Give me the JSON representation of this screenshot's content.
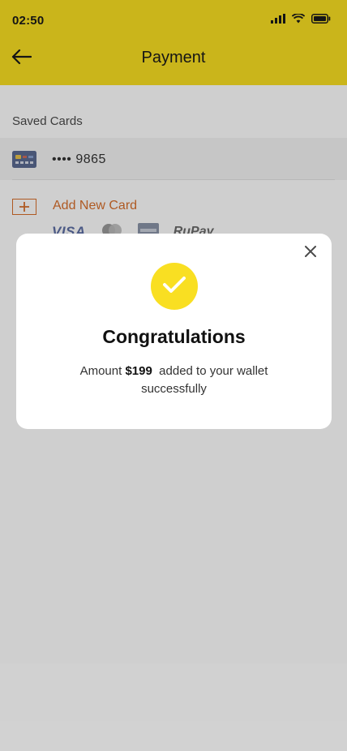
{
  "status_bar": {
    "time": "02:50",
    "signal_icon": "cellular-signal-icon",
    "wifi_icon": "wifi-icon",
    "battery_icon": "battery-icon"
  },
  "header": {
    "title": "Payment",
    "back_icon": "arrow-left-icon",
    "color": "#f9df22"
  },
  "saved_cards": {
    "section_title": "Saved Cards",
    "cards": [
      {
        "masked_number": "•••• 9865",
        "icon": "credit-card-icon"
      }
    ]
  },
  "add_card": {
    "label": "Add New Card",
    "icon": "plus-box-icon",
    "accent_color": "#d86f2c",
    "brands": [
      "VISA",
      "Mastercard",
      "Amex",
      "RuPay"
    ]
  },
  "modal": {
    "title": "Congratulations",
    "message_prefix": "Amount ",
    "amount": "$199",
    "message_suffix": "  added to your wallet successfully",
    "success_icon": "checkmark-icon",
    "close_icon": "close-icon"
  }
}
